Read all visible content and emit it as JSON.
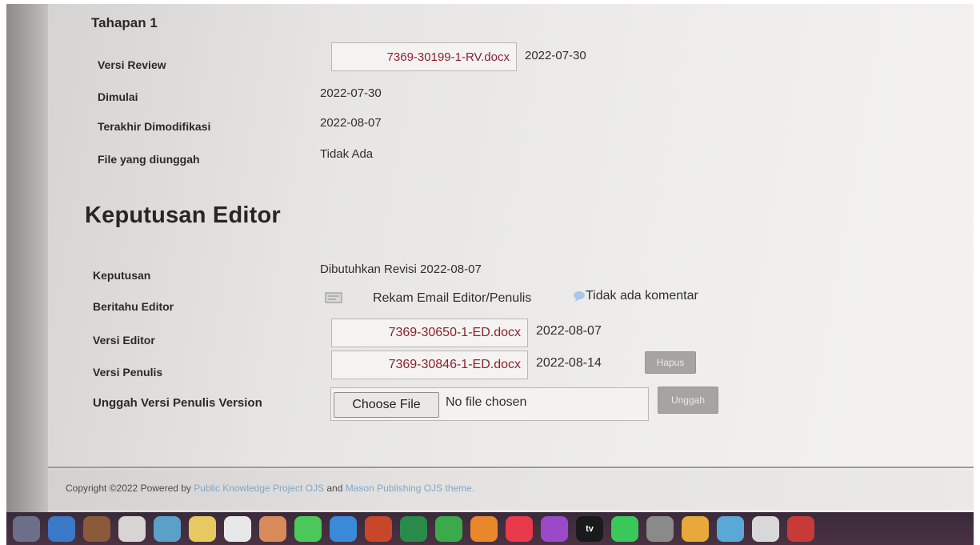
{
  "stage": {
    "title": "Tahapan 1",
    "rows": [
      {
        "label": "Versi Review",
        "file": "7369-30199-1-RV.docx",
        "date": "2022-07-30"
      },
      {
        "label": "Dimulai",
        "value": "2022-07-30"
      },
      {
        "label": "Terakhir Dimodifikasi",
        "value": "2022-08-07"
      },
      {
        "label": "File yang diunggah",
        "value": "Tidak Ada"
      }
    ]
  },
  "editor_decision": {
    "heading": "Keputusan Editor",
    "decision_label": "Keputusan",
    "decision_value": "Dibutuhkan Revisi 2022-08-07",
    "notify_label": "Beritahu Editor",
    "notify_link": "Rekam Email Editor/Penulis",
    "comment_link": "Tidak ada komentar",
    "editor_version_label": "Versi Editor",
    "editor_version_file": "7369-30650-1-ED.docx",
    "editor_version_date": "2022-08-07",
    "author_version_label": "Versi Penulis",
    "author_version_file": "7369-30846-1-ED.docx",
    "author_version_date": "2022-08-14",
    "delete_button": "Hapus",
    "upload_label": "Unggah Versi Penulis Version",
    "choose_file_button": "Choose File",
    "no_file_text": "No file chosen",
    "upload_button": "Unggah"
  },
  "footer": {
    "prefix": "Copyright ©2022 Powered by",
    "link1": "Public Knowledge Project OJS",
    "middle": "and",
    "link2": "Mason Publishing OJS theme."
  },
  "dock": {
    "items": [
      {
        "icon": "launchpad-icon",
        "color": "#6b6f8a"
      },
      {
        "icon": "finder-icon",
        "color": "#3a78c8"
      },
      {
        "icon": "photo-app-icon",
        "color": "#8a5a3a"
      },
      {
        "icon": "calendar-icon",
        "color": "#d8d4d4"
      },
      {
        "icon": "maps-icon",
        "color": "#5aa0c8"
      },
      {
        "icon": "notes-icon",
        "color": "#e8c860"
      },
      {
        "icon": "reminders-icon",
        "color": "#e8e8e8"
      },
      {
        "icon": "photos-icon",
        "color": "#d88a5a"
      },
      {
        "icon": "messages-icon",
        "color": "#4cc85a"
      },
      {
        "icon": "mail-icon",
        "color": "#3a8ad8"
      },
      {
        "icon": "powerpoint-icon",
        "color": "#c8462a"
      },
      {
        "icon": "excel-icon",
        "color": "#2a8a4a"
      },
      {
        "icon": "numbers-icon",
        "color": "#3aaa4a"
      },
      {
        "icon": "pages-icon",
        "color": "#e8882a"
      },
      {
        "icon": "music-icon",
        "color": "#e83a4a"
      },
      {
        "icon": "podcasts-icon",
        "color": "#9a4ac8"
      },
      {
        "icon": "apple-tv-icon",
        "color": "#1a1a1a",
        "text": "tv"
      },
      {
        "icon": "facetime-icon",
        "color": "#3ac85a"
      },
      {
        "icon": "system-preferences-icon",
        "color": "#8a8a8a"
      },
      {
        "icon": "books-icon",
        "color": "#e8a83a"
      },
      {
        "icon": "preview-icon",
        "color": "#5aa8d8"
      },
      {
        "icon": "chrome-icon",
        "color": "#d8d8d8"
      },
      {
        "icon": "app-icon",
        "color": "#c83a3a"
      }
    ]
  }
}
